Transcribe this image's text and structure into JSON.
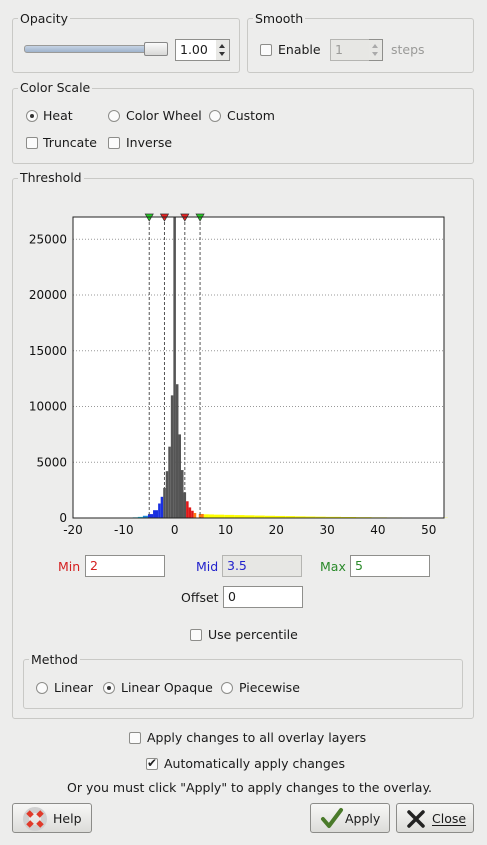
{
  "opacity": {
    "title": "Opacity",
    "value": "1.00",
    "slider_fraction": 1.0
  },
  "smooth": {
    "title": "Smooth",
    "enable_label": "Enable",
    "enabled": false,
    "steps_value": "1",
    "steps_label": "steps"
  },
  "color_scale": {
    "title": "Color Scale",
    "options": [
      "Heat",
      "Color Wheel",
      "Custom"
    ],
    "selected": "Heat",
    "truncate_label": "Truncate",
    "inverse_label": "Inverse"
  },
  "threshold": {
    "title": "Threshold",
    "min_label": "Min",
    "min_value": "2",
    "mid_label": "Mid",
    "mid_value": "3.5",
    "max_label": "Max",
    "max_value": "5",
    "offset_label": "Offset",
    "offset_value": "0",
    "use_percentile_label": "Use percentile",
    "method": {
      "title": "Method",
      "options": [
        "Linear",
        "Linear Opaque",
        "Piecewise"
      ],
      "selected": "Linear Opaque"
    }
  },
  "chart_data": {
    "type": "bar",
    "x_ticks": [
      -20,
      -10,
      0,
      10,
      20,
      30,
      40,
      50
    ],
    "y_ticks": [
      0,
      5000,
      10000,
      15000,
      20000,
      25000
    ],
    "xlim": [
      -20,
      53
    ],
    "ylim": [
      0,
      27000
    ],
    "grid": "horizontal dotted",
    "threshold_markers": [
      {
        "x": -5,
        "color": "#22cc22"
      },
      {
        "x": -2,
        "color": "#ee2222"
      },
      {
        "x": 2,
        "color": "#ee2222"
      },
      {
        "x": 5,
        "color": "#22cc22"
      }
    ],
    "bins": [
      {
        "x": -8,
        "y": 60
      },
      {
        "x": -7,
        "y": 100
      },
      {
        "x": -6,
        "y": 200
      },
      {
        "x": -5,
        "y": 350
      },
      {
        "x": -4,
        "y": 700
      },
      {
        "x": -3,
        "y": 1300
      },
      {
        "x": -2.5,
        "y": 1900
      },
      {
        "x": -2,
        "y": 2700
      },
      {
        "x": -1.5,
        "y": 4200
      },
      {
        "x": -1,
        "y": 6400
      },
      {
        "x": -0.5,
        "y": 11000
      },
      {
        "x": 0,
        "y": 27000
      },
      {
        "x": 0.5,
        "y": 12000
      },
      {
        "x": 1,
        "y": 7500
      },
      {
        "x": 1.5,
        "y": 4300
      },
      {
        "x": 2,
        "y": 2300
      },
      {
        "x": 2.5,
        "y": 1500
      },
      {
        "x": 3,
        "y": 950
      },
      {
        "x": 3.5,
        "y": 650
      },
      {
        "x": 4,
        "y": 450
      },
      {
        "x": 5,
        "y": 360
      },
      {
        "x": 6,
        "y": 330
      },
      {
        "x": 7,
        "y": 320
      },
      {
        "x": 8,
        "y": 300
      },
      {
        "x": 10,
        "y": 280
      },
      {
        "x": 12,
        "y": 260
      },
      {
        "x": 14,
        "y": 240
      },
      {
        "x": 16,
        "y": 220
      },
      {
        "x": 18,
        "y": 200
      },
      {
        "x": 20,
        "y": 185
      },
      {
        "x": 22,
        "y": 170
      },
      {
        "x": 24,
        "y": 150
      },
      {
        "x": 26,
        "y": 135
      },
      {
        "x": 28,
        "y": 120
      },
      {
        "x": 30,
        "y": 105
      },
      {
        "x": 33,
        "y": 90
      },
      {
        "x": 36,
        "y": 75
      },
      {
        "x": 39,
        "y": 60
      },
      {
        "x": 42,
        "y": 50
      },
      {
        "x": 45,
        "y": 40
      },
      {
        "x": 48,
        "y": 30
      },
      {
        "x": 51,
        "y": 20
      }
    ]
  },
  "apply_all_label": "Apply changes to all overlay layers",
  "apply_all_checked": false,
  "auto_apply_label": "Automatically apply changes",
  "auto_apply_checked": true,
  "hint": "Or you must click \"Apply\" to apply changes to the overlay.",
  "buttons": {
    "help": "Help",
    "apply": "Apply",
    "close": "Close"
  },
  "colors": {
    "min": "#d42020",
    "mid": "#2222cc",
    "max": "#2a8a2a"
  }
}
